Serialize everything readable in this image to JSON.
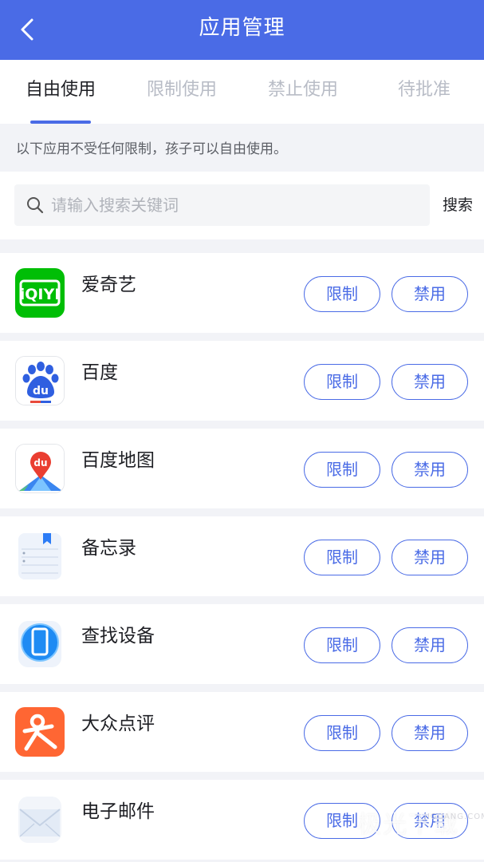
{
  "header": {
    "title": "应用管理",
    "back_icon": "chevron-left-icon"
  },
  "tabs": [
    {
      "label": "自由使用",
      "active": true
    },
    {
      "label": "限制使用",
      "active": false
    },
    {
      "label": "禁止使用",
      "active": false
    },
    {
      "label": "待批准",
      "active": false
    }
  ],
  "notice": "以下应用不受任何限制，孩子可以自由使用。",
  "search": {
    "placeholder": "请输入搜索关键词",
    "button": "搜索",
    "icon": "search-icon"
  },
  "apps": [
    {
      "name": "爱奇艺",
      "icon": "iqiyi-icon",
      "limit_label": "限制",
      "ban_label": "禁用"
    },
    {
      "name": "百度",
      "icon": "baidu-paw-icon",
      "limit_label": "限制",
      "ban_label": "禁用"
    },
    {
      "name": "百度地图",
      "icon": "baidu-map-icon",
      "limit_label": "限制",
      "ban_label": "禁用"
    },
    {
      "name": "备忘录",
      "icon": "notepad-icon",
      "limit_label": "限制",
      "ban_label": "禁用"
    },
    {
      "name": "查找设备",
      "icon": "find-device-icon",
      "limit_label": "限制",
      "ban_label": "禁用"
    },
    {
      "name": "大众点评",
      "icon": "dianping-icon",
      "limit_label": "限制",
      "ban_label": "禁用"
    },
    {
      "name": "电子邮件",
      "icon": "mail-icon",
      "limit_label": "限制",
      "ban_label": "禁用"
    }
  ],
  "colors": {
    "accent": "#4a6be6",
    "iqiyi": "#00be06",
    "dianping": "#ff6633",
    "background": "#f2f3f7"
  },
  "watermark": {
    "main": "极光下载",
    "sub": "JIGUANG.COM"
  }
}
